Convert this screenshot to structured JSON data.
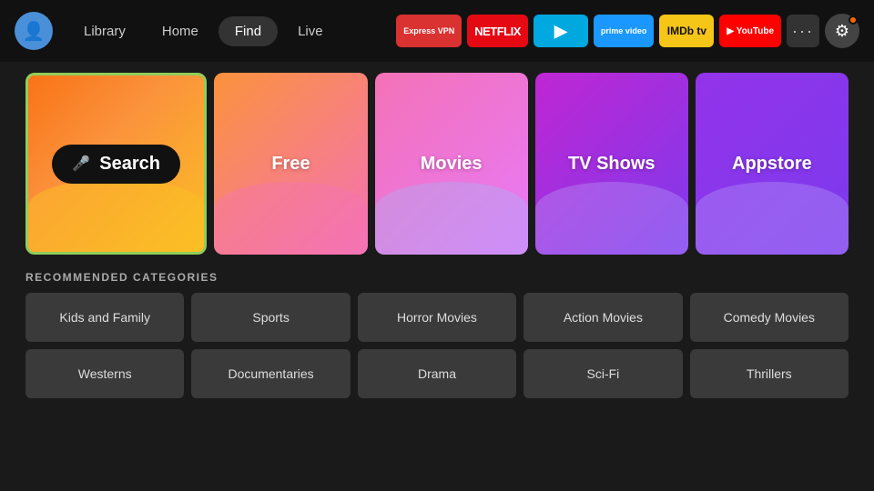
{
  "header": {
    "avatar_icon": "👤",
    "nav": {
      "items": [
        {
          "label": "Library",
          "active": false
        },
        {
          "label": "Home",
          "active": false
        },
        {
          "label": "Find",
          "active": true
        },
        {
          "label": "Live",
          "active": false
        }
      ]
    },
    "apps": [
      {
        "name": "ExpressVPN",
        "class": "app-expressvpn",
        "label": "Express VPN"
      },
      {
        "name": "Netflix",
        "class": "app-netflix",
        "label": "NETFLIX"
      },
      {
        "name": "Freevee",
        "class": "app-freevee",
        "label": "▶"
      },
      {
        "name": "Prime Video",
        "class": "app-primevideo",
        "label": "prime video"
      },
      {
        "name": "IMDb TV",
        "class": "app-imdb",
        "label": "IMDb tv"
      },
      {
        "name": "YouTube",
        "class": "app-youtube",
        "label": "▶ YouTube"
      }
    ],
    "more_label": "···",
    "settings_icon": "⚙"
  },
  "main": {
    "big_cards": [
      {
        "id": "search",
        "label": "Search",
        "type": "search"
      },
      {
        "id": "free",
        "label": "Free",
        "type": "free"
      },
      {
        "id": "movies",
        "label": "Movies",
        "type": "movies"
      },
      {
        "id": "tvshows",
        "label": "TV Shows",
        "type": "tvshows"
      },
      {
        "id": "appstore",
        "label": "Appstore",
        "type": "appstore"
      }
    ],
    "recommended_title": "RECOMMENDED CATEGORIES",
    "categories_row1": [
      {
        "label": "Kids and Family"
      },
      {
        "label": "Sports"
      },
      {
        "label": "Horror Movies"
      },
      {
        "label": "Action Movies"
      },
      {
        "label": "Comedy Movies"
      }
    ],
    "categories_row2": [
      {
        "label": "Westerns"
      },
      {
        "label": "Documentaries"
      },
      {
        "label": "Drama"
      },
      {
        "label": "Sci-Fi"
      },
      {
        "label": "Thrillers"
      }
    ]
  }
}
